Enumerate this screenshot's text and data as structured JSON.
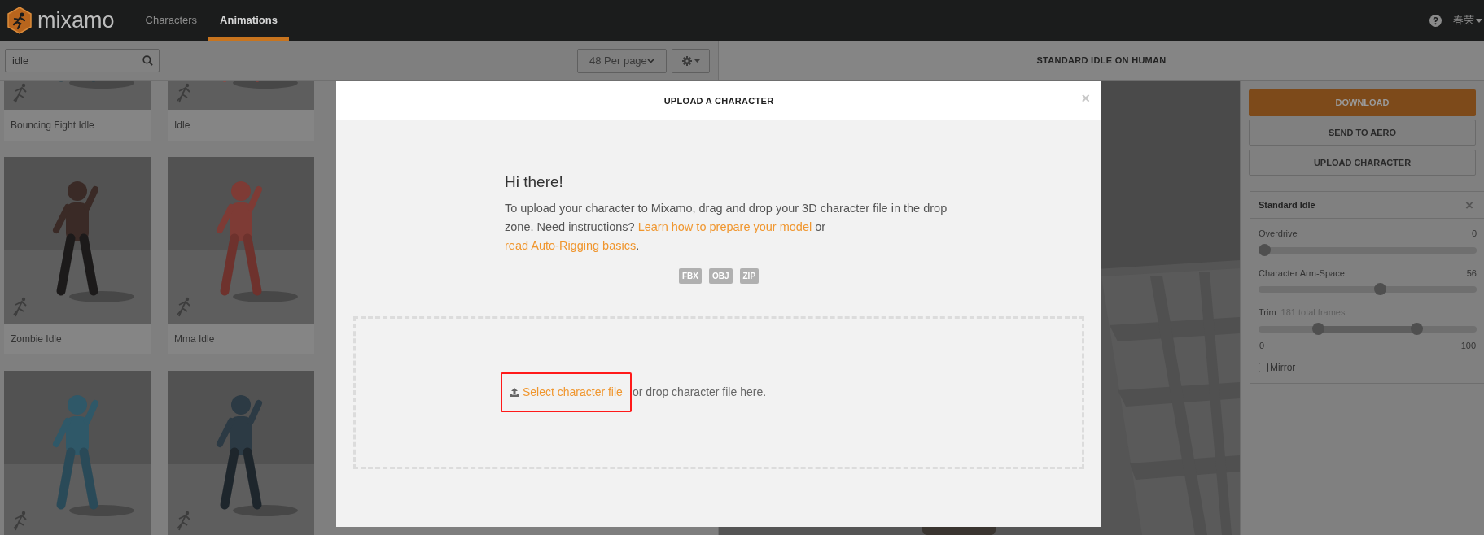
{
  "top_bar": {
    "logo": "mixamo",
    "tabs": [
      {
        "label": "Characters",
        "selected": false
      },
      {
        "label": "Animations",
        "selected": true
      }
    ],
    "user": "春荣"
  },
  "search": {
    "value": "idle"
  },
  "per_page": "48 Per page",
  "animation_cards": [
    {
      "kind": "card",
      "label": "Bouncing Fight Idle"
    },
    {
      "kind": "card",
      "label": "Idle"
    },
    {
      "kind": "card",
      "label": "Zombie Idle"
    },
    {
      "kind": "card",
      "label": "Mma Idle"
    },
    {
      "kind": "picture"
    },
    {
      "kind": "picture"
    }
  ],
  "preview": {
    "title": "STANDARD IDLE ON HUMAN"
  },
  "actions": [
    {
      "label": "DOWNLOAD",
      "kind": "primary"
    },
    {
      "label": "SEND TO AERO",
      "kind": "secondary"
    },
    {
      "label": "UPLOAD CHARACTER",
      "kind": "secondary"
    }
  ],
  "settings_panel": {
    "title": "Standard Idle",
    "close": "×",
    "sliders": [
      {
        "kind": "single",
        "label": "Overdrive",
        "reading": "0",
        "level": 0
      },
      {
        "kind": "single",
        "label": "Character Arm-Space",
        "reading": "56",
        "level": 0.56
      },
      {
        "kind": "range",
        "label": "Trim",
        "note": "181 total frames",
        "thumbs": [
          {
            "level": 0.26
          },
          {
            "level": 0.74
          }
        ],
        "min": "0",
        "max": "100"
      }
    ],
    "mirror": {
      "label": "Mirror",
      "checked": false
    }
  },
  "modal": {
    "title": "UPLOAD A CHARACTER",
    "close": "×",
    "heading": "Hi there!",
    "message": [
      {
        "kind": "text",
        "text": "To upload your character to Mixamo, drag and drop your 3D character file in the drop zone. Need instructions? "
      },
      {
        "kind": "link",
        "text": "Learn how to prepare your model"
      },
      {
        "kind": "text",
        "text": " or "
      },
      {
        "kind": "link",
        "text": "read Auto-Rigging basics"
      },
      {
        "kind": "text",
        "text": "."
      }
    ],
    "formats": [
      "FBX",
      "OBJ",
      "ZIP"
    ],
    "drop_zone": {
      "link": "Select character file",
      "highlighted": true,
      "text": "or drop character file here."
    }
  }
}
